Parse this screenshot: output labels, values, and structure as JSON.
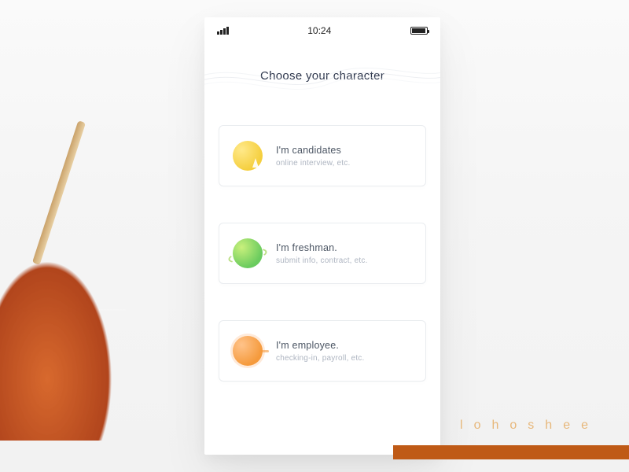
{
  "statusbar": {
    "time": "10:24"
  },
  "page": {
    "title": "Choose your character"
  },
  "options": [
    {
      "title": "I'm candidates",
      "subtitle": "online interview, etc.",
      "icon": "planet-yellow"
    },
    {
      "title": "I'm freshman.",
      "subtitle": "submit info, contract, etc.",
      "icon": "planet-green"
    },
    {
      "title": "I'm employee.",
      "subtitle": "checking-in, payroll, etc.",
      "icon": "planet-orange"
    }
  ],
  "brand": "lohoshee"
}
